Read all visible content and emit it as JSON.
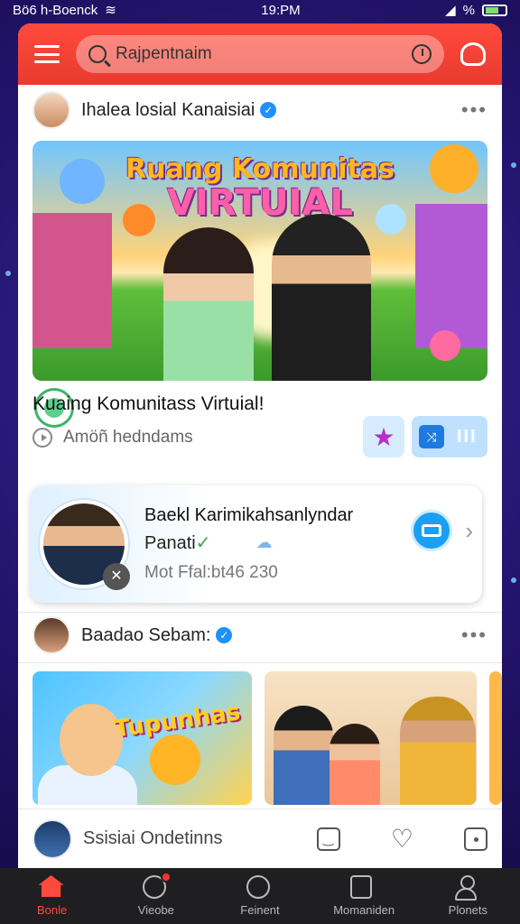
{
  "status_bar": {
    "left_text": "Bö6 h-Boenck",
    "time": "19:PM",
    "right_text": "%"
  },
  "header": {
    "search_placeholder": "Rajpentnaim"
  },
  "post1": {
    "author": "Ihalea losial Kanaisiai",
    "hero_title_line1": "Ruang Komunitas",
    "hero_title_line2": "VIRTUIAL",
    "title": "Kuaing Komunitass Virtuial!",
    "subtitle": "Amöñ hedndams"
  },
  "promo": {
    "title": "Baekl Karimikahsanlyndar",
    "name": "Panati",
    "meta": "Mot Ffal:bt46 230"
  },
  "post2": {
    "author": "Baadao Sebam:",
    "thumb1_text": "Tupunhas"
  },
  "comment_bar": {
    "placeholder": "Ssisiai Ondetinns"
  },
  "bottom_nav": {
    "items": [
      {
        "label": "Bonle",
        "icon": "home-icon",
        "active": true
      },
      {
        "label": "Vieobe",
        "icon": "search-icon",
        "active": false
      },
      {
        "label": "Feinent",
        "icon": "compass-icon",
        "active": false
      },
      {
        "label": "Momaniden",
        "icon": "library-icon",
        "active": false
      },
      {
        "label": "Plonets",
        "icon": "profile-icon",
        "active": false
      }
    ]
  },
  "colors": {
    "accent": "#ff4a3d",
    "verified": "#1e90ff",
    "background": "#23146e"
  }
}
